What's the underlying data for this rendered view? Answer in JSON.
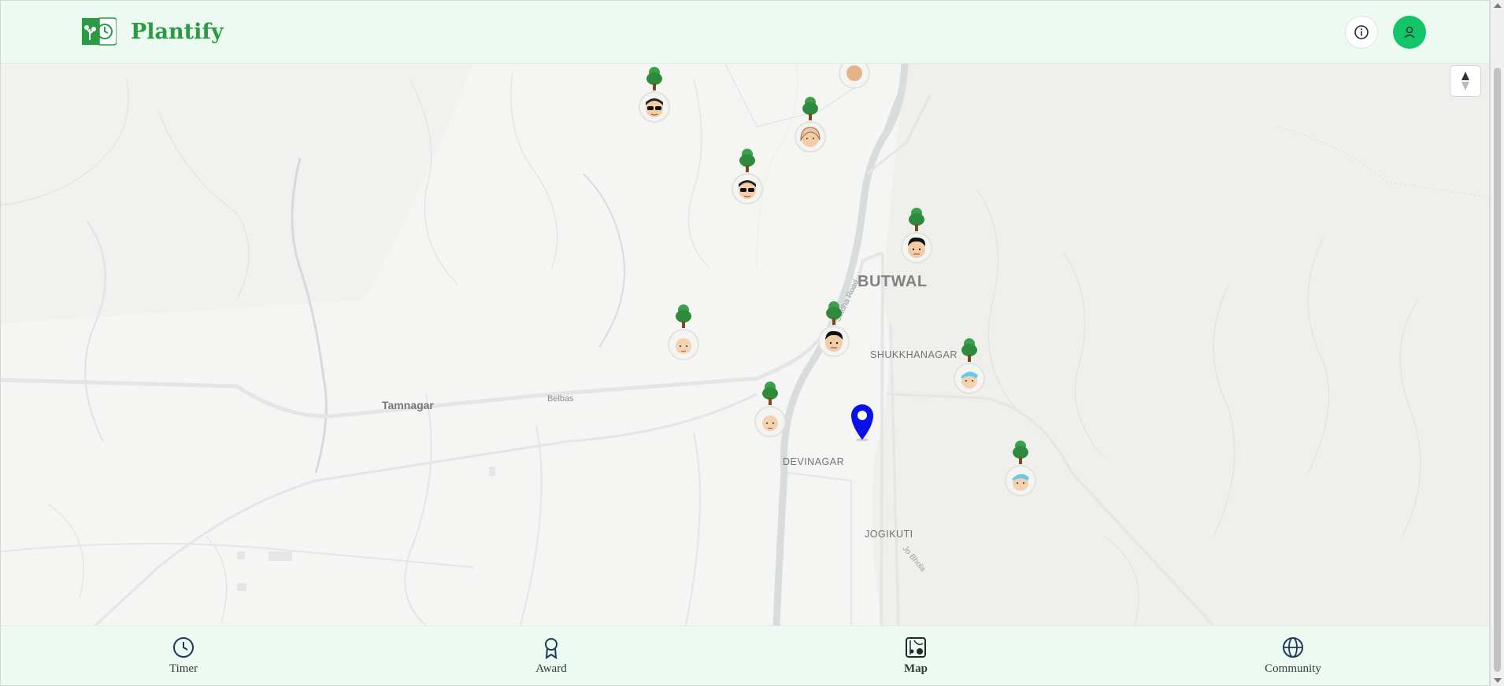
{
  "app": {
    "name": "Plantify"
  },
  "header": {
    "info_icon": "info-icon",
    "profile_icon": "user-icon"
  },
  "map": {
    "labels": {
      "butwal": "BUTWAL",
      "shukkhanagar": "SHUKKHANAGAR",
      "devinagar": "DEVINAGAR",
      "jogikuti": "JOGIKUTI",
      "tamnagar": "Tamnagar",
      "belbas": "Belbas",
      "road1": "Siddha Road",
      "road2": "Jo Bhola"
    },
    "markers_icon": "tree-icon",
    "current_location_icon": "location-pin-icon",
    "compass_icon": "compass-icon"
  },
  "nav": {
    "items": [
      {
        "label": "Timer",
        "icon": "clock-icon"
      },
      {
        "label": "Award",
        "icon": "award-icon"
      },
      {
        "label": "Map",
        "icon": "map-icon",
        "active": true
      },
      {
        "label": "Community",
        "icon": "globe-icon"
      }
    ]
  },
  "colors": {
    "brand": "#2a9a45",
    "accent": "#14c46a",
    "header_bg": "#edfaf1",
    "pin": "#0a10e8",
    "tree": "#2e8b3d"
  }
}
